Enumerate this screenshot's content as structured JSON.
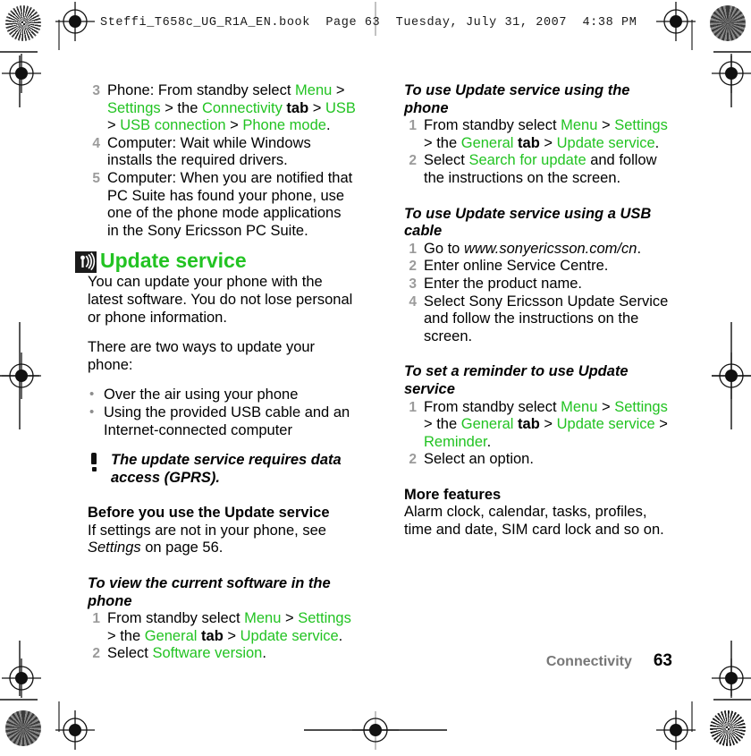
{
  "page": {
    "header_line": "Steffi_T658c_UG_R1A_EN.book  Page 63  Tuesday, July 31, 2007  4:38 PM",
    "footer_section": "Connectivity",
    "footer_page_number": "63"
  },
  "colors": {
    "ui_term_green": "#22c322",
    "heading_green": "#22c322",
    "list_number_gray": "#9b9b9b",
    "footer_gray": "#777777",
    "body_black": "#000000",
    "icon_black": "#1b1b1b"
  },
  "left_column": {
    "continued_steps": [
      {
        "num": "3",
        "segments": [
          {
            "text": "Phone: From standby select ",
            "style": "plain"
          },
          {
            "text": "Menu",
            "style": "green"
          },
          {
            "text": " > ",
            "style": "plain"
          },
          {
            "text": "Settings",
            "style": "green"
          },
          {
            "text": " > the ",
            "style": "plain"
          },
          {
            "text": "Connectivity",
            "style": "green"
          },
          {
            "text": " ",
            "style": "plain"
          },
          {
            "text": "tab",
            "style": "bold"
          },
          {
            "text": " > ",
            "style": "plain"
          },
          {
            "text": "USB",
            "style": "green"
          },
          {
            "text": " > ",
            "style": "plain"
          },
          {
            "text": "USB connection",
            "style": "green"
          },
          {
            "text": " > ",
            "style": "plain"
          },
          {
            "text": "Phone mode",
            "style": "green"
          },
          {
            "text": ".",
            "style": "plain"
          }
        ]
      },
      {
        "num": "4",
        "segments": [
          {
            "text": "Computer: Wait while Windows installs the required drivers.",
            "style": "plain"
          }
        ]
      },
      {
        "num": "5",
        "segments": [
          {
            "text": "Computer: When you are notified that PC Suite has found your phone, use one of the phone mode applications in the Sony Ericsson PC Suite.",
            "style": "plain"
          }
        ]
      }
    ],
    "section": {
      "icon_name": "over-the-air-update-icon",
      "heading": "Update service",
      "intro_paragraph": "You can update your phone with the latest software. You do not lose personal or phone information.",
      "second_paragraph": "There are two ways to update your phone:",
      "bullets": [
        "Over the air using your phone",
        "Using the provided USB cable and an Internet-connected computer"
      ],
      "note": {
        "icon_name": "exclamation-note-icon",
        "text": "The update service requires data access (GPRS)."
      },
      "before_heading": "Before you use the Update service",
      "before_text_segments": [
        {
          "text": "If settings are not in your phone, see ",
          "style": "plain"
        },
        {
          "text": "Settings",
          "style": "italic"
        },
        {
          "text": " on page 56.",
          "style": "plain"
        }
      ],
      "procedure_view_software": {
        "title": "To view the current software in the phone",
        "steps": [
          {
            "num": "1",
            "segments": [
              {
                "text": "From standby select ",
                "style": "plain"
              },
              {
                "text": "Menu",
                "style": "green"
              },
              {
                "text": " > ",
                "style": "plain"
              },
              {
                "text": "Settings",
                "style": "green"
              },
              {
                "text": " > the ",
                "style": "plain"
              },
              {
                "text": "General",
                "style": "green"
              },
              {
                "text": " ",
                "style": "plain"
              },
              {
                "text": "tab",
                "style": "bold"
              },
              {
                "text": " > ",
                "style": "plain"
              },
              {
                "text": "Update service",
                "style": "green"
              },
              {
                "text": ".",
                "style": "plain"
              }
            ]
          },
          {
            "num": "2",
            "segments": [
              {
                "text": "Select ",
                "style": "plain"
              },
              {
                "text": "Software version",
                "style": "green"
              },
              {
                "text": ".",
                "style": "plain"
              }
            ]
          }
        ]
      }
    }
  },
  "right_column": {
    "procedure_use_phone": {
      "title": "To use Update service using the phone",
      "steps": [
        {
          "num": "1",
          "segments": [
            {
              "text": "From standby select ",
              "style": "plain"
            },
            {
              "text": "Menu",
              "style": "green"
            },
            {
              "text": " > ",
              "style": "plain"
            },
            {
              "text": "Settings",
              "style": "green"
            },
            {
              "text": " > the ",
              "style": "plain"
            },
            {
              "text": "General",
              "style": "green"
            },
            {
              "text": " ",
              "style": "plain"
            },
            {
              "text": "tab",
              "style": "bold"
            },
            {
              "text": " > ",
              "style": "plain"
            },
            {
              "text": "Update service",
              "style": "green"
            },
            {
              "text": ".",
              "style": "plain"
            }
          ]
        },
        {
          "num": "2",
          "segments": [
            {
              "text": "Select ",
              "style": "plain"
            },
            {
              "text": "Search for update",
              "style": "green"
            },
            {
              "text": " and follow the instructions on the screen.",
              "style": "plain"
            }
          ]
        }
      ]
    },
    "procedure_use_usb": {
      "title": "To use Update service using a USB cable",
      "steps": [
        {
          "num": "1",
          "segments": [
            {
              "text": "Go to ",
              "style": "plain"
            },
            {
              "text": "www.sonyericsson.com/cn",
              "style": "italic"
            },
            {
              "text": ".",
              "style": "plain"
            }
          ]
        },
        {
          "num": "2",
          "segments": [
            {
              "text": "Enter online Service Centre.",
              "style": "plain"
            }
          ]
        },
        {
          "num": "3",
          "segments": [
            {
              "text": "Enter the product name.",
              "style": "plain"
            }
          ]
        },
        {
          "num": "4",
          "segments": [
            {
              "text": "Select Sony Ericsson Update Service and follow the instructions on the screen.",
              "style": "plain"
            }
          ]
        }
      ]
    },
    "procedure_reminder": {
      "title": "To set a reminder to use Update service",
      "steps": [
        {
          "num": "1",
          "segments": [
            {
              "text": "From standby select ",
              "style": "plain"
            },
            {
              "text": "Menu",
              "style": "green"
            },
            {
              "text": " > ",
              "style": "plain"
            },
            {
              "text": "Settings",
              "style": "green"
            },
            {
              "text": " > the ",
              "style": "plain"
            },
            {
              "text": "General",
              "style": "green"
            },
            {
              "text": " ",
              "style": "plain"
            },
            {
              "text": "tab",
              "style": "bold"
            },
            {
              "text": " > ",
              "style": "plain"
            },
            {
              "text": "Update service",
              "style": "green"
            },
            {
              "text": " > ",
              "style": "plain"
            },
            {
              "text": "Reminder",
              "style": "green"
            },
            {
              "text": ".",
              "style": "plain"
            }
          ]
        },
        {
          "num": "2",
          "segments": [
            {
              "text": "Select an option.",
              "style": "plain"
            }
          ]
        }
      ]
    },
    "more_features": {
      "heading": "More features",
      "text": "Alarm clock, calendar, tasks, profiles, time and date, SIM card lock and so on."
    }
  }
}
